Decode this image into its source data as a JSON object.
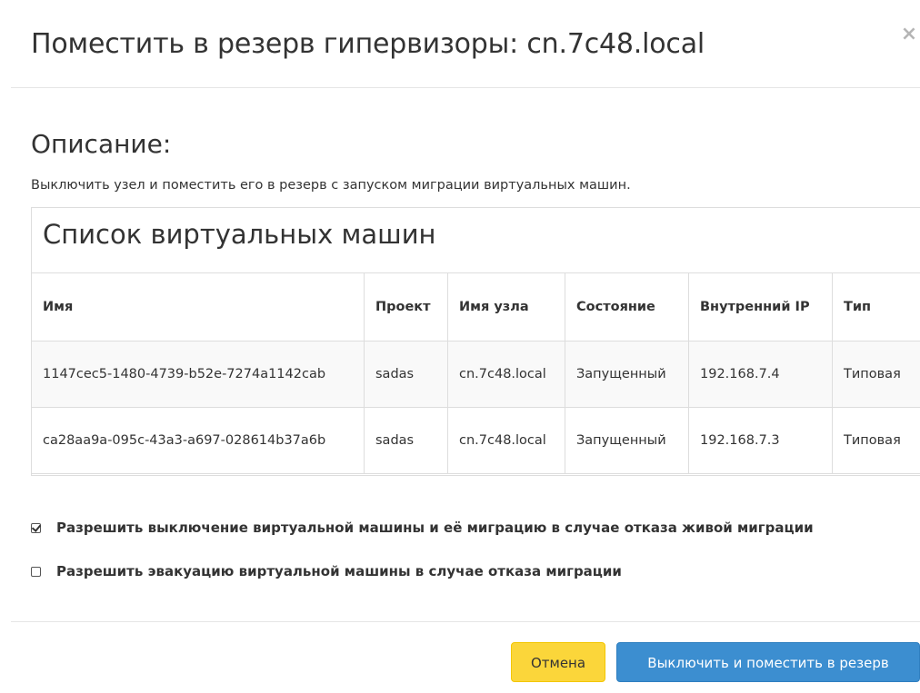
{
  "modal": {
    "title": "Поместить в резерв гипервизоры: cn.7c48.local",
    "close_symbol": "×"
  },
  "description": {
    "heading": "Описание:",
    "text": "Выключить узел и поместить его в резерв с запуском миграции виртуальных машин."
  },
  "vm_list": {
    "caption": "Список виртуальных машин",
    "columns": [
      "Имя",
      "Проект",
      "Имя узла",
      "Состояние",
      "Внутренний IP",
      "Тип"
    ],
    "rows": [
      {
        "name": "1147cec5-1480-4739-b52e-7274a1142cab",
        "project": "sadas",
        "host": "cn.7c48.local",
        "state": "Запущенный",
        "ip": "192.168.7.4",
        "type": "Типовая"
      },
      {
        "name": "ca28aa9a-095c-43a3-a697-028614b37a6b",
        "project": "sadas",
        "host": "cn.7c48.local",
        "state": "Запущенный",
        "ip": "192.168.7.3",
        "type": "Типовая"
      }
    ]
  },
  "options": [
    {
      "label": "Разрешить выключение виртуальной машины и её миграцию в случае отказа живой миграции",
      "checked": true
    },
    {
      "label": "Разрешить эвакуацию виртуальной машины в случае отказа миграции",
      "checked": false
    }
  ],
  "buttons": {
    "cancel": "Отмена",
    "submit": "Выключить и поместить в резерв"
  },
  "colors": {
    "cancel_bg": "#fbd63a",
    "primary_bg": "#3c8ed0"
  }
}
